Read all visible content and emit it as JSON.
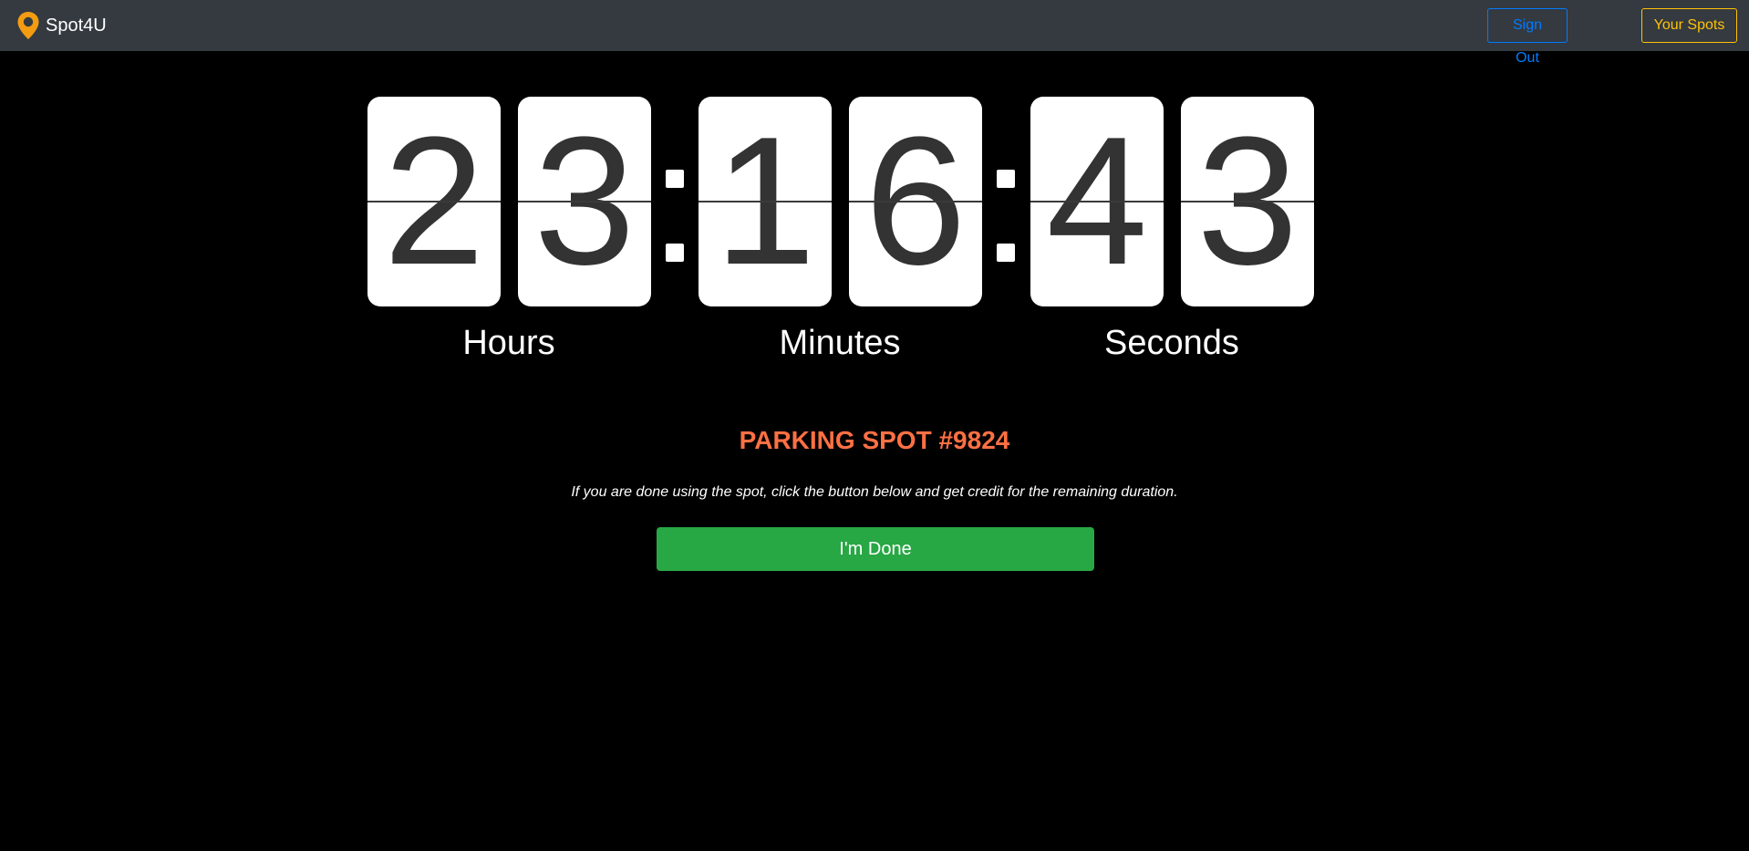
{
  "navbar": {
    "brand": "Spot4U",
    "brand_icon": "map-pin-icon",
    "brand_icon_color": "#f39c12",
    "sign_out_label": "Sign Out",
    "your_spots_label": "Your Spots",
    "sign_out_color": "#007bff",
    "your_spots_color": "#ffc107"
  },
  "countdown": {
    "hours": [
      "2",
      "3"
    ],
    "minutes": [
      "1",
      "6"
    ],
    "seconds": [
      "4",
      "3"
    ],
    "labels": {
      "hours": "Hours",
      "minutes": "Minutes",
      "seconds": "Seconds"
    }
  },
  "spot": {
    "title": "PARKING SPOT #9824",
    "title_color": "#ff7043",
    "note": "If you are done using the spot, click the button below and get credit for the remaining duration.",
    "done_label": "I'm Done",
    "done_color": "#28a745"
  }
}
